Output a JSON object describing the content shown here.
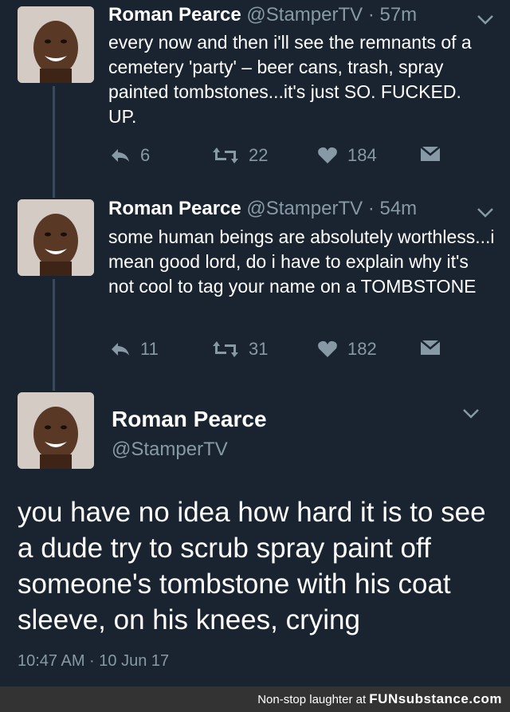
{
  "tweets": [
    {
      "name": "Roman Pearce",
      "meta": "@StamperTV · 57m",
      "text": "every now and then i'll see the remnants of a cemetery 'party' – beer cans, trash, spray painted tombstones...it's just SO. FUCKED. UP.",
      "replies": "6",
      "retweets": "22",
      "likes": "184"
    },
    {
      "name": "Roman Pearce",
      "meta": "@StamperTV · 54m",
      "text": "some human beings are absolutely worthless...i mean good lord, do i have to explain why it's not cool to tag your name on a TOMBSTONE",
      "replies": "11",
      "retweets": "31",
      "likes": "182"
    }
  ],
  "main_tweet": {
    "name": "Roman Pearce",
    "handle": "@StamperTV",
    "text": "you have no idea how hard it is to see a dude try to scrub spray paint off someone's tombstone with his coat sleeve, on his knees, crying",
    "timestamp": "10:47 AM · 10 Jun 17"
  },
  "footer": {
    "prefix": "Non-stop laughter at",
    "brand": "FUNsubstance.com"
  },
  "colors": {
    "background": "#1a2430",
    "secondary_text": "#8899a6",
    "footer_bg": "#333333"
  },
  "icons": [
    "reply-icon",
    "retweet-icon",
    "heart-icon",
    "dm-icon",
    "chevron-down-icon"
  ]
}
